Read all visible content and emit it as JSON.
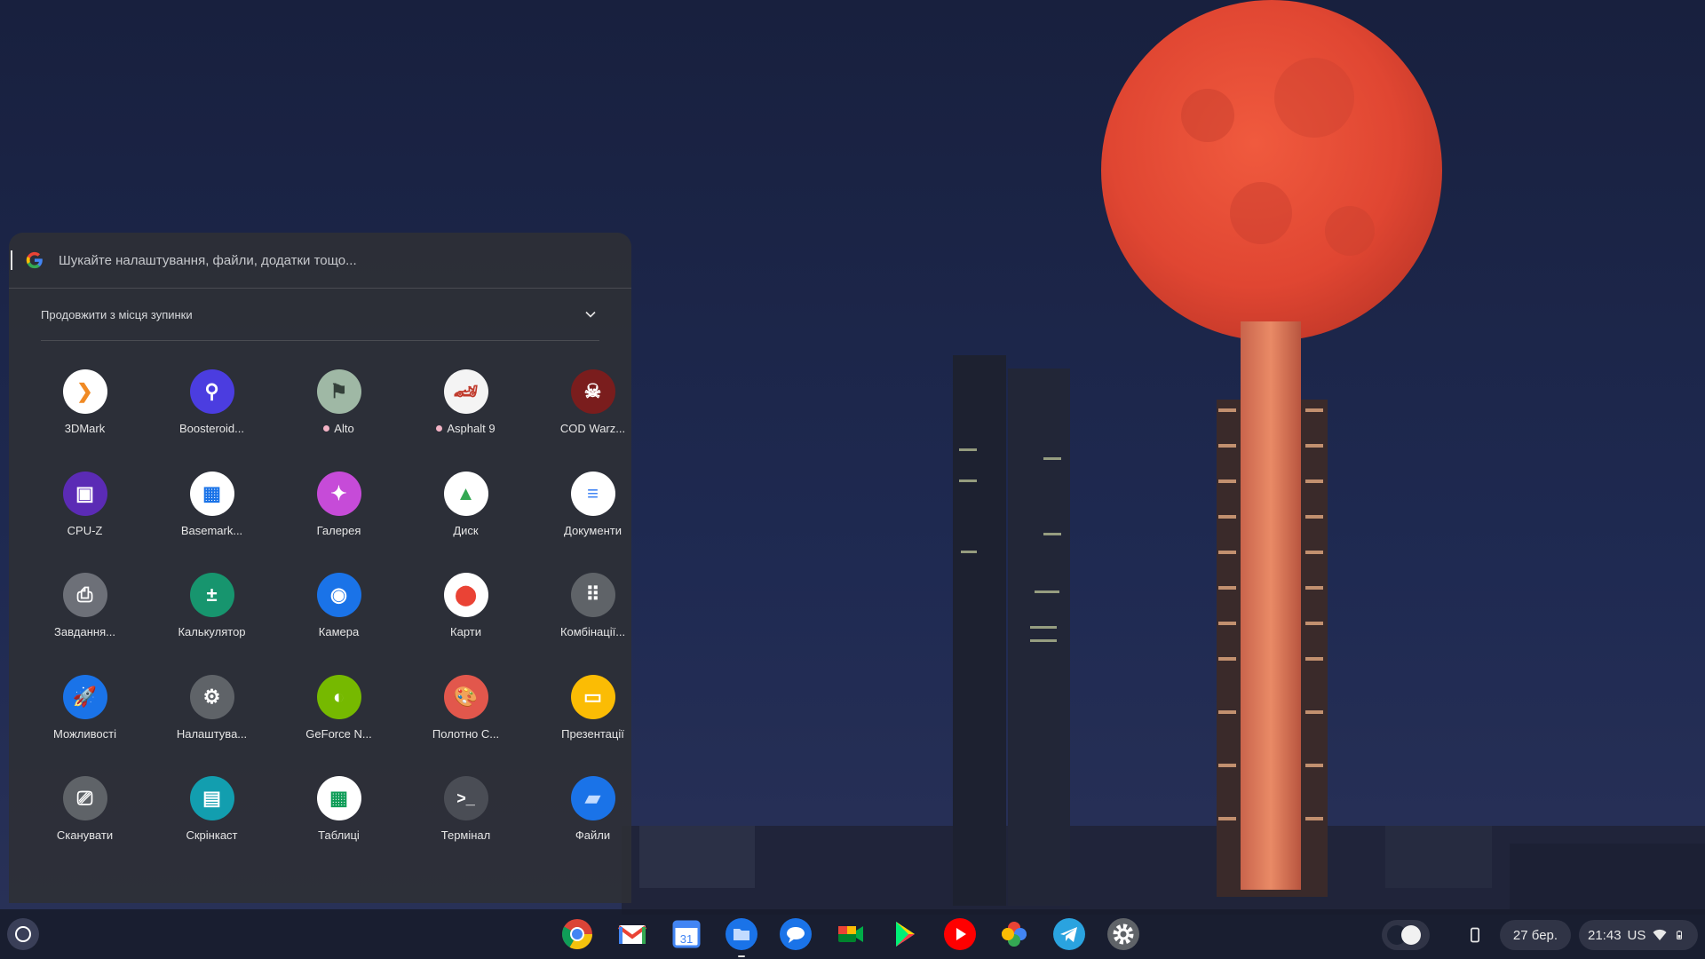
{
  "colors": {
    "launcher_bg": "#2e3036",
    "shelf_bg": "#181c2c",
    "sky": "#1c2447",
    "moon": "#e24b36"
  },
  "search": {
    "placeholder": "Шукайте налаштування, файли, додатки тощо..."
  },
  "continue": {
    "label": "Продовжити з місця зупинки"
  },
  "apps": [
    {
      "label": "3DMark",
      "icon": "3dmark-icon"
    },
    {
      "label": "Boosteroid...",
      "icon": "boosteroid-icon"
    },
    {
      "label": "Alto",
      "icon": "alto-icon",
      "new": true
    },
    {
      "label": "Asphalt 9",
      "icon": "asphalt-icon",
      "new": true
    },
    {
      "label": "COD Warz...",
      "icon": "cod-warzone-icon"
    },
    {
      "label": "CPU-Z",
      "icon": "cpu-z-icon"
    },
    {
      "label": "Basemark...",
      "icon": "basemark-icon"
    },
    {
      "label": "Галерея",
      "icon": "gallery-icon"
    },
    {
      "label": "Диск",
      "icon": "drive-icon"
    },
    {
      "label": "Документи",
      "icon": "docs-icon"
    },
    {
      "label": "Завдання...",
      "icon": "print-jobs-icon"
    },
    {
      "label": "Калькулятор",
      "icon": "calculator-icon"
    },
    {
      "label": "Камера",
      "icon": "camera-icon"
    },
    {
      "label": "Карти",
      "icon": "maps-icon"
    },
    {
      "label": "Комбінації...",
      "icon": "shortcuts-icon"
    },
    {
      "label": "Можливості",
      "icon": "explore-icon"
    },
    {
      "label": "Налаштува...",
      "icon": "settings-icon"
    },
    {
      "label": "GeForce N...",
      "icon": "geforce-now-icon"
    },
    {
      "label": "Полотно С...",
      "icon": "canvas-icon"
    },
    {
      "label": "Презентації",
      "icon": "slides-icon"
    },
    {
      "label": "Сканувати",
      "icon": "scan-icon"
    },
    {
      "label": "Скрінкаст",
      "icon": "screencast-icon"
    },
    {
      "label": "Таблиці",
      "icon": "sheets-icon"
    },
    {
      "label": "Термінал",
      "icon": "terminal-icon"
    },
    {
      "label": "Файли",
      "icon": "files-icon"
    }
  ],
  "shelf": {
    "pinned": [
      "chrome-icon",
      "gmail-icon",
      "calendar-icon",
      "files-icon",
      "messages-icon",
      "meet-icon",
      "play-store-icon",
      "youtube-icon",
      "photos-icon",
      "telegram-icon",
      "settings-icon"
    ],
    "calendar_day": "31",
    "date": "27 бер.",
    "time": "21:43",
    "keyboard": "US"
  }
}
